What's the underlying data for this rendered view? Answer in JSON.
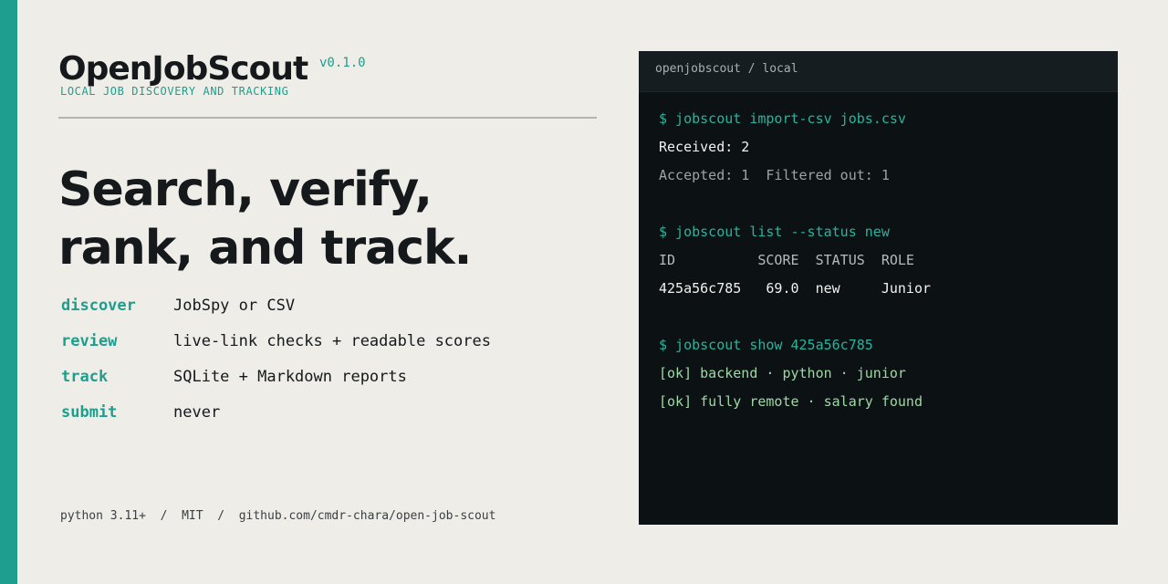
{
  "brand": {
    "name": "OpenJobScout",
    "version": "v0.1.0",
    "tagline": "LOCAL JOB DISCOVERY AND TRACKING"
  },
  "headline": {
    "line1": "Search, verify,",
    "line2": "rank, and track."
  },
  "features": [
    {
      "key": "discover",
      "desc": "JobSpy or CSV"
    },
    {
      "key": "review",
      "desc": "live-link checks + readable scores"
    },
    {
      "key": "track",
      "desc": "SQLite + Markdown reports"
    },
    {
      "key": "submit",
      "desc": "never"
    }
  ],
  "footer": {
    "python": "python 3.11+",
    "license": "MIT",
    "repo": "github.com/cmdr-chara/open-job-scout",
    "sep": "/"
  },
  "terminal": {
    "title": "openjobscout / local",
    "lines": [
      {
        "kind": "cmd",
        "text": "$ jobscout import-csv jobs.csv"
      },
      {
        "kind": "out",
        "text": "Received: 2"
      },
      {
        "kind": "dim",
        "text": "Accepted: 1  Filtered out: 1"
      },
      {
        "kind": "blank",
        "text": ""
      },
      {
        "kind": "cmd",
        "text": "$ jobscout list --status new"
      },
      {
        "kind": "head",
        "text": "ID          SCORE  STATUS  ROLE"
      },
      {
        "kind": "out",
        "text": "425a56c785   69.0  new     Junior"
      },
      {
        "kind": "blank",
        "text": ""
      },
      {
        "kind": "cmd",
        "text": "$ jobscout show 425a56c785"
      },
      {
        "kind": "ok",
        "text": "[ok] backend · python · junior"
      },
      {
        "kind": "ok",
        "text": "[ok] fully remote · salary found"
      }
    ]
  },
  "colors": {
    "accent": "#1e9e8c",
    "background": "#eeede8",
    "terminal_bg": "#0c1114",
    "terminal_ok": "#9fd8a6"
  }
}
